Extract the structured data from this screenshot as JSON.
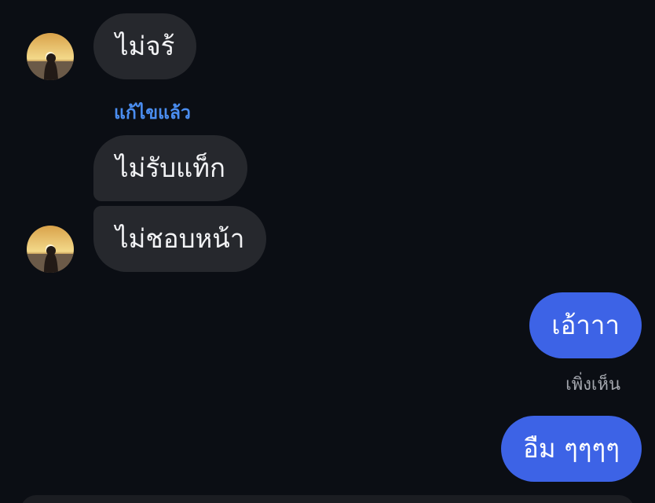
{
  "conversation": {
    "messages": [
      {
        "side": "incoming",
        "text": "ไม่จร้"
      },
      {
        "side": "incoming",
        "edited_label": "แก้ไขแล้ว",
        "text": "ไม่รับแท็ก"
      },
      {
        "side": "incoming",
        "text": "ไม่ชอบหน้า"
      },
      {
        "side": "outgoing",
        "text": "เอ้าาา"
      },
      {
        "side": "outgoing",
        "text": "อืม ๆๆๆๆ"
      }
    ],
    "seen_label": "เพิ่งเห็น"
  },
  "colors": {
    "background": "#0b0e14",
    "incoming_bubble": "#26282d",
    "outgoing_bubble": "#3d63e6",
    "edited_label": "#4a8df0",
    "seen_label": "#a3a6ad"
  },
  "icons": {
    "avatar": "contact-avatar-sunset-photo"
  }
}
